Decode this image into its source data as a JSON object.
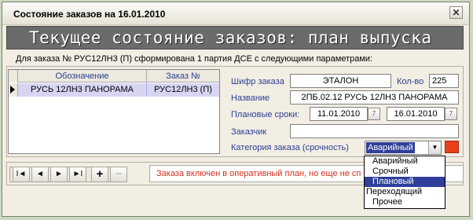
{
  "window": {
    "title": "Состояние заказов на 16.01.2010",
    "close_glyph": "✕"
  },
  "banner": {
    "text": "Текущее состояние заказов: план выпуска"
  },
  "info_line": "Для заказа № РУС12ЛН3 (П) сформирована  1 партия ДСЕ с следующими параметрами:",
  "grid": {
    "columns": [
      "Обозначение",
      "Заказ №"
    ],
    "rows": [
      {
        "designation": "РУСЬ 12ЛН3 ПАНОРАМА",
        "order_no": "РУС12ЛН3 (П)"
      }
    ]
  },
  "form": {
    "code_label": "Шифр заказа",
    "code_value": "ЭТАЛОН",
    "qty_label": "Кол-во",
    "qty_value": "225",
    "name_label": "Название",
    "name_value": "2ПБ.02.12 РУСЬ 12ЛН3 ПАНОРАМА",
    "dates_label": "Плановые сроки:",
    "date_from": "11.01.2010",
    "date_to": "16.01.2010",
    "date_icon_text": "7",
    "customer_label": "Заказчик",
    "customer_value": "",
    "category_label": "Категория заказа (срочность)",
    "category_value": "Аварийный",
    "category_color": "#e8401c"
  },
  "navigator": {
    "first": "I◄",
    "prev": "◄",
    "next": "►",
    "last": "►I",
    "add": "+",
    "delete": "−"
  },
  "status_text": "Заказа включен в оперативный план, но еще не сп",
  "dropdown": {
    "options": [
      "Аварийный",
      "Срочный",
      "Плановый",
      "Переходящий",
      "Прочее"
    ],
    "selected": "Плановый"
  },
  "icons": {
    "close": "close-icon",
    "date": "calendar-icon",
    "combo": "chevron-down-icon",
    "row": "row-indicator-icon"
  }
}
